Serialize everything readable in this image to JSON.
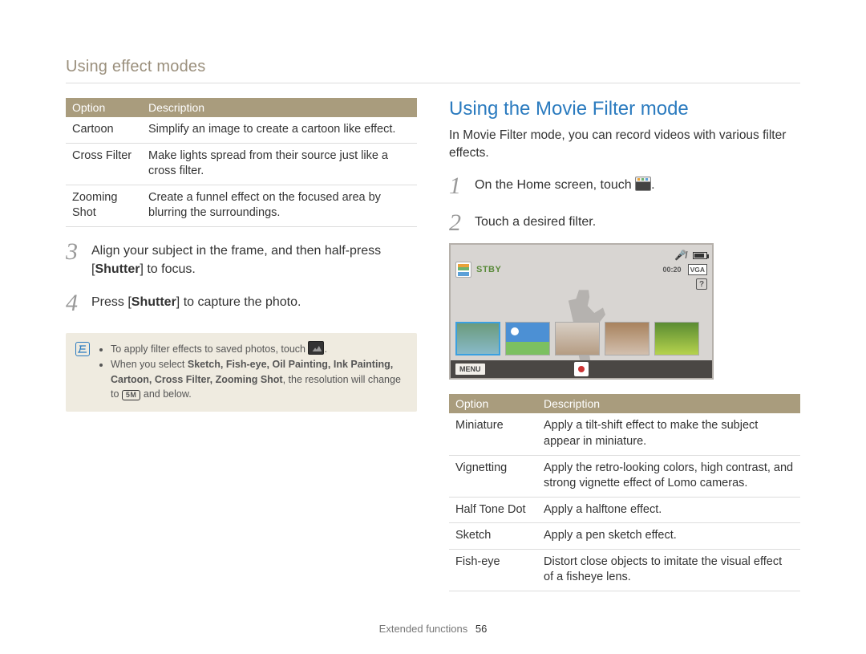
{
  "breadcrumb": "Using effect modes",
  "left": {
    "table_headers": {
      "option": "Option",
      "description": "Description"
    },
    "rows": [
      {
        "option": "Cartoon",
        "description": "Simplify an image to create a cartoon like effect."
      },
      {
        "option": "Cross Filter",
        "description": "Make lights spread from their source just like a cross filter."
      },
      {
        "option": "Zooming Shot",
        "description": "Create a funnel effect on the focused area by blurring the surroundings."
      }
    ],
    "steps": {
      "3": {
        "num": "3",
        "text_a": "Align your subject in the frame, and then half-press [",
        "bold_a": "Shutter",
        "text_b": "] to focus."
      },
      "4": {
        "num": "4",
        "text_a": "Press [",
        "bold_a": "Shutter",
        "text_b": "] to capture the photo."
      }
    },
    "note": {
      "bullet1_a": "To apply filter effects to saved photos, touch ",
      "bullet1_b": ".",
      "bullet2_a": "When you select ",
      "bold_list": "Sketch, Fish-eye, Oil Painting, Ink Painting, Cartoon, Cross Filter, Zooming Shot",
      "bullet2_b": ", the resolution will change to ",
      "badge": "5M",
      "bullet2_c": " and below."
    }
  },
  "right": {
    "heading": "Using the Movie Filter mode",
    "intro": "In Movie Filter mode, you can record videos with various filter effects.",
    "steps": {
      "1": {
        "num": "1",
        "text_a": "On the Home screen, touch ",
        "text_b": "."
      },
      "2": {
        "num": "2",
        "text": "Touch a desired filter."
      }
    },
    "lcd": {
      "stby": "STBY",
      "time": "00:20",
      "vga": "VGA",
      "q": "?",
      "menu": "MENU"
    },
    "table_headers": {
      "option": "Option",
      "description": "Description"
    },
    "rows": [
      {
        "option": "Miniature",
        "description": "Apply a tilt-shift effect to make the subject appear in miniature."
      },
      {
        "option": "Vignetting",
        "description": "Apply the retro-looking colors, high contrast, and strong vignette effect of Lomo cameras."
      },
      {
        "option": "Half Tone Dot",
        "description": "Apply a halftone effect."
      },
      {
        "option": "Sketch",
        "description": "Apply a pen sketch effect."
      },
      {
        "option": "Fish-eye",
        "description": "Distort close objects to imitate the visual effect of a fisheye lens."
      }
    ]
  },
  "footer": {
    "section": "Extended functions",
    "page": "56"
  }
}
